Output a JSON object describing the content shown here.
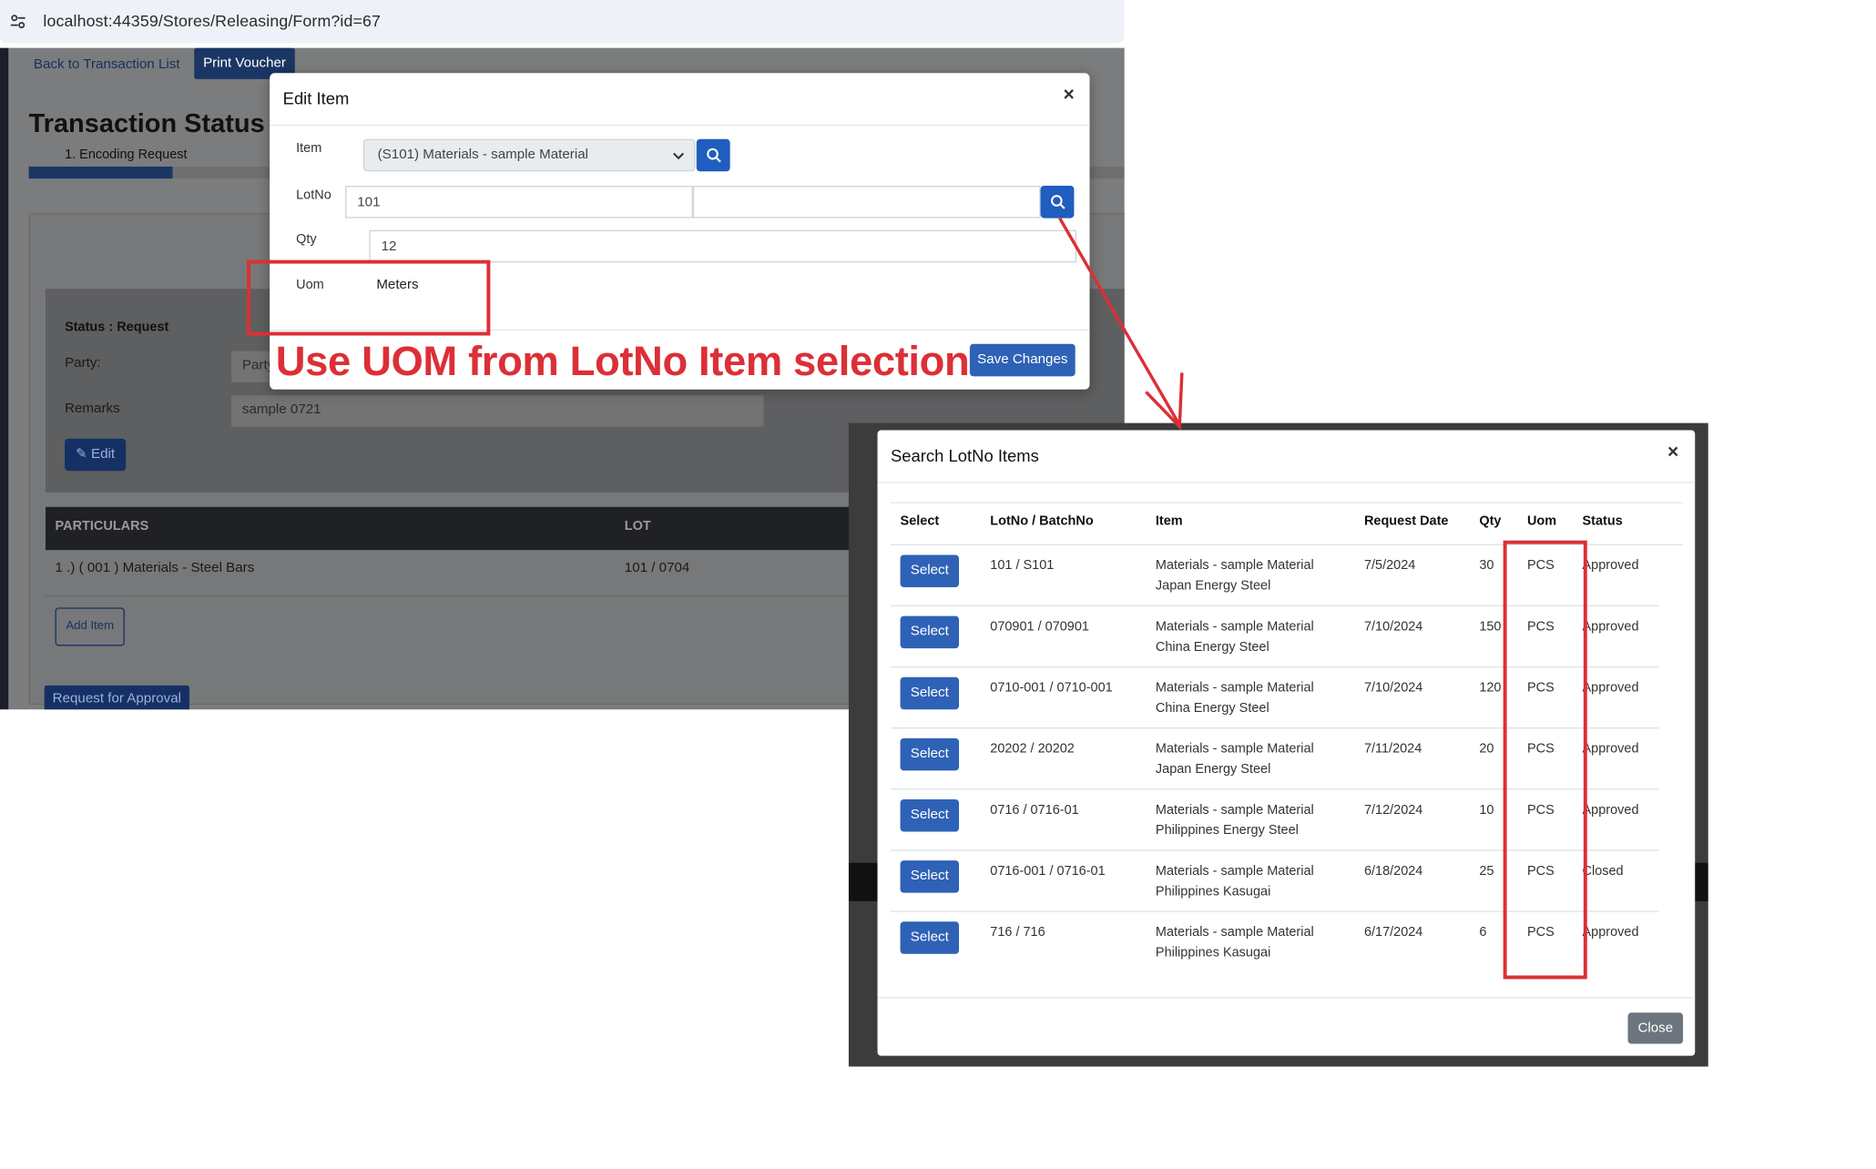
{
  "browser": {
    "url": "localhost:44359/Stores/Releasing/Form?id=67"
  },
  "page": {
    "back_label": "Back to Transaction List",
    "print_label": "Print Voucher",
    "status_title": "Transaction Status :",
    "step_label": "1. Encoding Request",
    "status_label": "Status : Request",
    "party_label": "Party:",
    "party_value": "Party",
    "remarks_label": "Remarks",
    "remarks_value": "sample 0721",
    "edit_label": "Edit",
    "col_particulars": "PARTICULARS",
    "col_lot": "LOT",
    "row_particular": "1 .) ( 001 ) Materials - Steel Bars",
    "row_lot": "101 / 0704",
    "add_item_label": "Add Item",
    "request_approval_label": "Request for Approval"
  },
  "edit_modal": {
    "title": "Edit Item",
    "close": "×",
    "item_label": "Item",
    "item_value": "(S101) Materials - sample Material",
    "lotno_label": "LotNo",
    "lotno_value": "101",
    "lotno_value2": "",
    "qty_label": "Qty",
    "qty_value": "12",
    "uom_label": "Uom",
    "uom_value": "Meters",
    "save_label": "Save Changes"
  },
  "annotation": {
    "text": "Use UOM from LotNo Item selection",
    "color": "#dc2f36"
  },
  "search_modal": {
    "title": "Search LotNo Items",
    "close": "×",
    "headers": {
      "select": "Select",
      "lot": "LotNo / BatchNo",
      "item": "Item",
      "date": "Request Date",
      "qty": "Qty",
      "uom": "Uom",
      "status": "Status"
    },
    "select_label": "Select",
    "rows": [
      {
        "lot": "101 / S101",
        "item1": "Materials - sample Material",
        "item2": "Japan Energy Steel",
        "date": "7/5/2024",
        "qty": "30",
        "uom": "PCS",
        "status": "Approved"
      },
      {
        "lot": "070901 / 070901",
        "item1": "Materials - sample Material",
        "item2": "China Energy Steel",
        "date": "7/10/2024",
        "qty": "150",
        "uom": "PCS",
        "status": "Approved"
      },
      {
        "lot": "0710-001 / 0710-001",
        "item1": "Materials - sample Material",
        "item2": "China Energy Steel",
        "date": "7/10/2024",
        "qty": "120",
        "uom": "PCS",
        "status": "Approved"
      },
      {
        "lot": "20202 / 20202",
        "item1": "Materials - sample Material",
        "item2": "Japan Energy Steel",
        "date": "7/11/2024",
        "qty": "20",
        "uom": "PCS",
        "status": "Approved"
      },
      {
        "lot": "0716 / 0716-01",
        "item1": "Materials - sample Material",
        "item2": "Philippines Energy Steel",
        "date": "7/12/2024",
        "qty": "10",
        "uom": "PCS",
        "status": "Approved"
      },
      {
        "lot": "0716-001 / 0716-01",
        "item1": "Materials - sample Material",
        "item2": "Philippines Kasugai",
        "date": "6/18/2024",
        "qty": "25",
        "uom": "PCS",
        "status": "Closed"
      },
      {
        "lot": "716 / 716",
        "item1": "Materials - sample Material",
        "item2": "Philippines Kasugai",
        "date": "6/17/2024",
        "qty": "6",
        "uom": "PCS",
        "status": "Approved"
      }
    ],
    "close_label": "Close"
  },
  "colors": {
    "primary": "#2e62b6",
    "annotation": "#dc2f36",
    "secondary": "#6c757d"
  }
}
